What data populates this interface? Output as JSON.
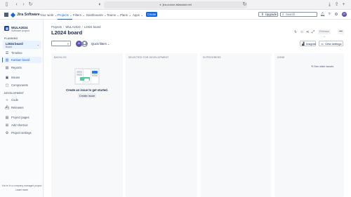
{
  "browser": {
    "url": "jira-ounce.atlassian.net"
  },
  "topnav": {
    "logo": "Jira Software",
    "items": [
      {
        "label": "Your work",
        "caret": "⌄"
      },
      {
        "label": "Projects",
        "caret": "⌄"
      },
      {
        "label": "Filters",
        "caret": "⌄"
      },
      {
        "label": "Dashboards",
        "caret": "⌄"
      },
      {
        "label": "Teams",
        "caret": "⌄"
      },
      {
        "label": "Plans",
        "caret": "⌄"
      },
      {
        "label": "Apps",
        "caret": "⌄"
      }
    ],
    "create": "Create",
    "upgrade": "Upgrade",
    "search_placeholder": "Search",
    "avatar": "JK"
  },
  "sidebar": {
    "project_name": "WULA2024",
    "project_type": "Software project",
    "planning_header": "PLANNING",
    "board": {
      "title": "L2024 board",
      "subtitle": "Board"
    },
    "planning_items": [
      {
        "label": "Timeline",
        "icon": "timeline-icon"
      },
      {
        "label": "Kanban board",
        "icon": "board-icon"
      },
      {
        "label": "Reports",
        "icon": "reports-icon"
      }
    ],
    "other_items": [
      {
        "label": "Issues",
        "icon": "issues-icon"
      },
      {
        "label": "Components",
        "icon": "components-icon"
      }
    ],
    "development_header": "DEVELOPMENT",
    "dev_items": [
      {
        "label": "Code",
        "icon": "code-icon"
      },
      {
        "label": "Releases",
        "icon": "releases-icon"
      }
    ],
    "bottom_items": [
      {
        "label": "Project pages",
        "icon": "pages-icon"
      },
      {
        "label": "Add shortcut",
        "icon": "shortcut-icon"
      },
      {
        "label": "Project settings",
        "icon": "settings-icon"
      }
    ],
    "managed_note": "You're in a company-managed project",
    "learn_more": "Learn more"
  },
  "main": {
    "breadcrumbs": [
      "Projects",
      "WULA2024",
      "L2024 board"
    ],
    "title": "L2024 board",
    "release": "Release",
    "more": "•••",
    "quick_filters": "Quick filters",
    "avatars": [
      "JK",
      ""
    ],
    "insights": "Insights",
    "view_settings": "View settings",
    "columns": [
      {
        "title": "BACKLOG"
      },
      {
        "title": "SELECTED FOR DEVELOPMENT"
      },
      {
        "title": "IN PROGRESS"
      },
      {
        "title": "DONE"
      }
    ],
    "empty_title": "Create an issue to get started.",
    "create_issue": "Create issue",
    "see_older": "See older issues"
  },
  "colors": {
    "brand": "#0c66e4",
    "sidebar_bg": "#fafbfc",
    "column_bg": "#f7f8f9"
  }
}
